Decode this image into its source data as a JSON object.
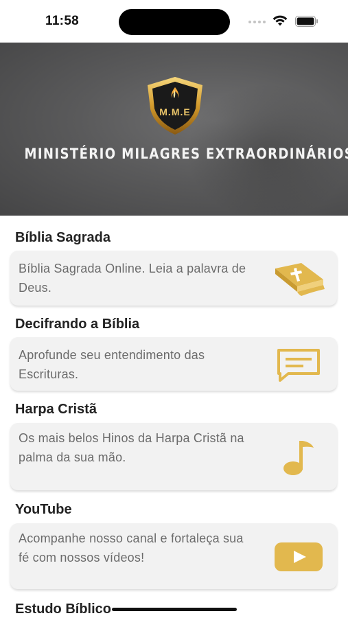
{
  "status_bar": {
    "time": "11:58"
  },
  "header": {
    "logo_text": "M.M.E",
    "title": "MINISTÉRIO MILAGRES EXTRAORDINÁRIOS"
  },
  "sections": [
    {
      "title": "Bíblia Sagrada",
      "description": "Bíblia Sagrada Online. Leia a palavra de Deus.",
      "icon": "bible-book-icon"
    },
    {
      "title": "Decifrando a Bíblia",
      "description": "Aprofunde seu entendimento das Escrituras.",
      "icon": "chat-message-icon"
    },
    {
      "title": "Harpa Cristã",
      "description": "Os mais belos Hinos da Harpa Cristã na palma da sua mão.",
      "icon": "music-note-icon"
    },
    {
      "title": "YouTube",
      "description": "Acompanhe nosso canal e fortaleça sua fé com nossos vídeos!",
      "icon": "youtube-play-icon"
    },
    {
      "title": "Estudo Bíblico"
    }
  ],
  "colors": {
    "accent": "#e2b84e",
    "card_bg": "#f2f2f2",
    "banner_bg": "#5a5a5b"
  }
}
